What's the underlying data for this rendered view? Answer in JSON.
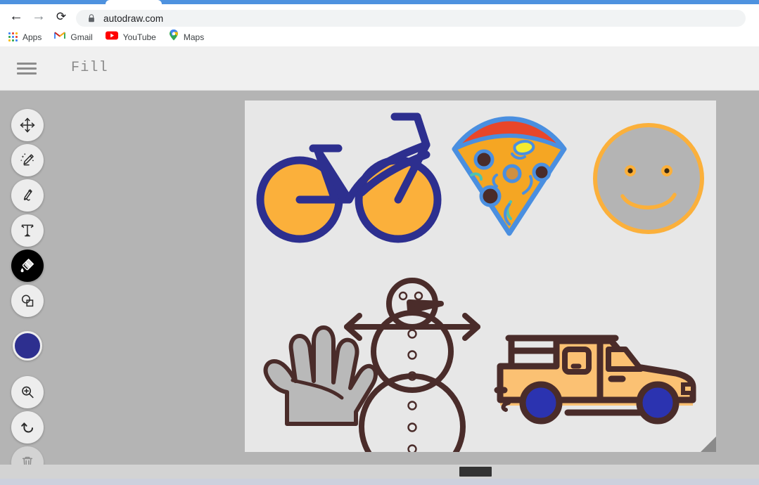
{
  "browser": {
    "nav": {
      "back_label": "←",
      "forward_label": "→",
      "reload_label": "⟳"
    },
    "omnibox": {
      "url": "autodraw.com",
      "lock_icon": "padlock-icon"
    },
    "bookmarks": [
      {
        "label": "Apps",
        "icon": "apps-grid-icon"
      },
      {
        "label": "Gmail",
        "icon": "gmail-icon"
      },
      {
        "label": "YouTube",
        "icon": "youtube-icon"
      },
      {
        "label": "Maps",
        "icon": "google-maps-pin-icon"
      }
    ]
  },
  "app": {
    "header": {
      "menu_icon": "hamburger-menu-icon",
      "title": "Fill"
    },
    "toolbar": {
      "items": [
        {
          "name": "select",
          "icon": "move-arrows-icon",
          "label": "Select",
          "active": false
        },
        {
          "name": "autodraw",
          "icon": "magic-pencil-icon",
          "label": "AutoDraw",
          "active": false
        },
        {
          "name": "draw",
          "icon": "pen-icon",
          "label": "Draw",
          "active": false
        },
        {
          "name": "text",
          "icon": "text-t-icon",
          "label": "Type",
          "active": false
        },
        {
          "name": "fill",
          "icon": "paint-bucket-icon",
          "label": "Fill",
          "active": true
        },
        {
          "name": "shape",
          "icon": "shapes-icon",
          "label": "Shape",
          "active": false
        }
      ],
      "color_swatch": {
        "name": "color-swatch",
        "label": "Color",
        "value": "#2d2f8f"
      },
      "bottom_items": [
        {
          "name": "zoom",
          "icon": "magnifier-plus-icon",
          "label": "Zoom"
        },
        {
          "name": "undo",
          "icon": "undo-arrow-icon",
          "label": "Undo"
        },
        {
          "name": "delete",
          "icon": "trash-can-icon",
          "label": "Delete"
        }
      ]
    },
    "canvas": {
      "background": "#e7e7e7",
      "resize_handle": "resize-corner-handle",
      "drawings": [
        {
          "name": "bicycle",
          "stroke": "#2d2f8f",
          "fill": "#fbb03b"
        },
        {
          "name": "pizza-slice",
          "stroke": "#4a8fe0",
          "fill": "#f5a623",
          "crust": "#e8462a",
          "topping": "#5b2c28",
          "highlight": "#f5ec2e"
        },
        {
          "name": "smiley-face",
          "stroke": "#fbb03b",
          "fill": "#b4b4b4"
        },
        {
          "name": "hand",
          "stroke": "#4a2c2a",
          "fill": "#b9b9b9"
        },
        {
          "name": "snowman",
          "stroke": "#4a2c2a",
          "fill": "none"
        },
        {
          "name": "pickup-truck",
          "stroke": "#4a2c2a",
          "fill": "#fbc173",
          "wheels": "#2b33b0"
        }
      ]
    }
  },
  "colors": {
    "workspace": "#b4b4b4",
    "header": "#f0f0f0",
    "accent_blue": "#4e92df",
    "tool_active": "#000000",
    "scrollbar_thumb": "#333333"
  },
  "scrollbar": {
    "name": "horizontal-scrollbar",
    "thumb_position_pct": 61
  }
}
